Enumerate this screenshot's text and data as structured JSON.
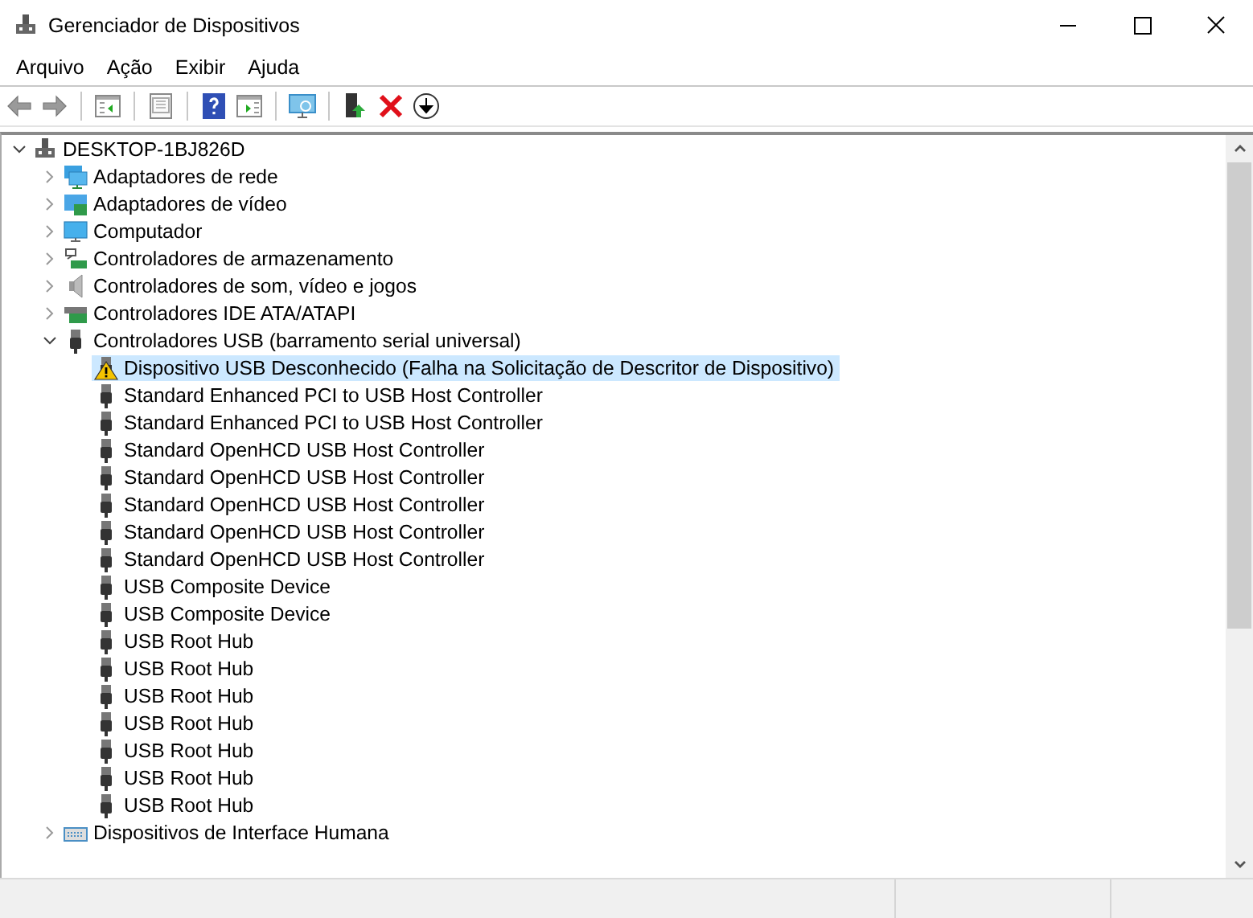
{
  "window": {
    "title": "Gerenciador de Dispositivos"
  },
  "menu": [
    "Arquivo",
    "Ação",
    "Exibir",
    "Ajuda"
  ],
  "tree": [
    {
      "label": "DESKTOP-1BJ826D",
      "kind": "computer-root",
      "expanded": true,
      "selected": false,
      "children": [
        {
          "label": "Adaptadores de rede",
          "kind": "network",
          "expanded": false,
          "selected": false
        },
        {
          "label": "Adaptadores de vídeo",
          "kind": "display",
          "expanded": false,
          "selected": false
        },
        {
          "label": "Computador",
          "kind": "monitor",
          "expanded": false,
          "selected": false
        },
        {
          "label": "Controladores de armazenamento",
          "kind": "storage",
          "expanded": false,
          "selected": false
        },
        {
          "label": "Controladores de som, vídeo e jogos",
          "kind": "sound",
          "expanded": false,
          "selected": false
        },
        {
          "label": "Controladores IDE ATA/ATAPI",
          "kind": "ide",
          "expanded": false,
          "selected": false
        },
        {
          "label": "Controladores USB (barramento serial universal)",
          "kind": "usb",
          "expanded": true,
          "selected": false,
          "children": [
            {
              "label": "Dispositivo USB Desconhecido (Falha na Solicitação de Descritor de Dispositivo)",
              "kind": "warning",
              "selected": true
            },
            {
              "label": "Standard Enhanced PCI to USB Host Controller",
              "kind": "usb",
              "selected": false
            },
            {
              "label": "Standard Enhanced PCI to USB Host Controller",
              "kind": "usb",
              "selected": false
            },
            {
              "label": "Standard OpenHCD USB Host Controller",
              "kind": "usb",
              "selected": false
            },
            {
              "label": "Standard OpenHCD USB Host Controller",
              "kind": "usb",
              "selected": false
            },
            {
              "label": "Standard OpenHCD USB Host Controller",
              "kind": "usb",
              "selected": false
            },
            {
              "label": "Standard OpenHCD USB Host Controller",
              "kind": "usb",
              "selected": false
            },
            {
              "label": "Standard OpenHCD USB Host Controller",
              "kind": "usb",
              "selected": false
            },
            {
              "label": "USB Composite Device",
              "kind": "usb",
              "selected": false
            },
            {
              "label": "USB Composite Device",
              "kind": "usb",
              "selected": false
            },
            {
              "label": "USB Root Hub",
              "kind": "usb",
              "selected": false
            },
            {
              "label": "USB Root Hub",
              "kind": "usb",
              "selected": false
            },
            {
              "label": "USB Root Hub",
              "kind": "usb",
              "selected": false
            },
            {
              "label": "USB Root Hub",
              "kind": "usb",
              "selected": false
            },
            {
              "label": "USB Root Hub",
              "kind": "usb",
              "selected": false
            },
            {
              "label": "USB Root Hub",
              "kind": "usb",
              "selected": false
            },
            {
              "label": "USB Root Hub",
              "kind": "usb",
              "selected": false
            }
          ]
        },
        {
          "label": "Dispositivos de Interface Humana",
          "kind": "keyboard",
          "expanded": false,
          "selected": false
        }
      ]
    }
  ]
}
